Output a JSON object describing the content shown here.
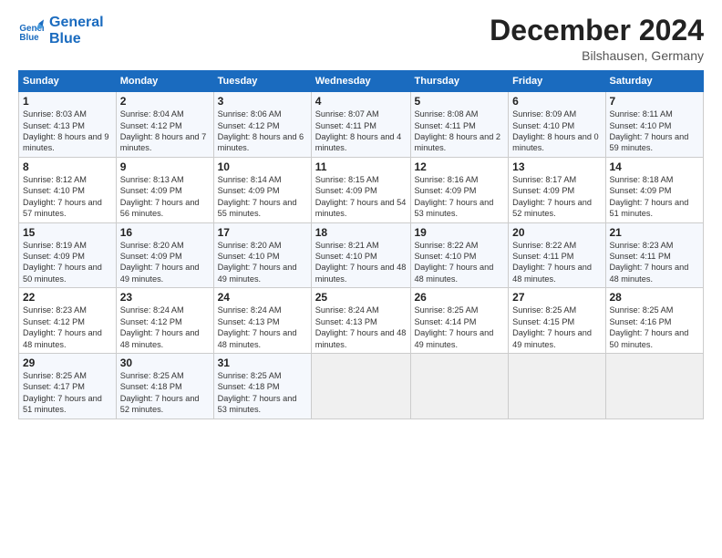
{
  "logo": {
    "line1": "General",
    "line2": "Blue"
  },
  "header": {
    "month": "December 2024",
    "location": "Bilshausen, Germany"
  },
  "days_of_week": [
    "Sunday",
    "Monday",
    "Tuesday",
    "Wednesday",
    "Thursday",
    "Friday",
    "Saturday"
  ],
  "weeks": [
    [
      {
        "day": "1",
        "sunrise": "8:03 AM",
        "sunset": "4:13 PM",
        "daylight": "8 hours and 9 minutes."
      },
      {
        "day": "2",
        "sunrise": "8:04 AM",
        "sunset": "4:12 PM",
        "daylight": "8 hours and 7 minutes."
      },
      {
        "day": "3",
        "sunrise": "8:06 AM",
        "sunset": "4:12 PM",
        "daylight": "8 hours and 6 minutes."
      },
      {
        "day": "4",
        "sunrise": "8:07 AM",
        "sunset": "4:11 PM",
        "daylight": "8 hours and 4 minutes."
      },
      {
        "day": "5",
        "sunrise": "8:08 AM",
        "sunset": "4:11 PM",
        "daylight": "8 hours and 2 minutes."
      },
      {
        "day": "6",
        "sunrise": "8:09 AM",
        "sunset": "4:10 PM",
        "daylight": "8 hours and 0 minutes."
      },
      {
        "day": "7",
        "sunrise": "8:11 AM",
        "sunset": "4:10 PM",
        "daylight": "7 hours and 59 minutes."
      }
    ],
    [
      {
        "day": "8",
        "sunrise": "8:12 AM",
        "sunset": "4:10 PM",
        "daylight": "7 hours and 57 minutes."
      },
      {
        "day": "9",
        "sunrise": "8:13 AM",
        "sunset": "4:09 PM",
        "daylight": "7 hours and 56 minutes."
      },
      {
        "day": "10",
        "sunrise": "8:14 AM",
        "sunset": "4:09 PM",
        "daylight": "7 hours and 55 minutes."
      },
      {
        "day": "11",
        "sunrise": "8:15 AM",
        "sunset": "4:09 PM",
        "daylight": "7 hours and 54 minutes."
      },
      {
        "day": "12",
        "sunrise": "8:16 AM",
        "sunset": "4:09 PM",
        "daylight": "7 hours and 53 minutes."
      },
      {
        "day": "13",
        "sunrise": "8:17 AM",
        "sunset": "4:09 PM",
        "daylight": "7 hours and 52 minutes."
      },
      {
        "day": "14",
        "sunrise": "8:18 AM",
        "sunset": "4:09 PM",
        "daylight": "7 hours and 51 minutes."
      }
    ],
    [
      {
        "day": "15",
        "sunrise": "8:19 AM",
        "sunset": "4:09 PM",
        "daylight": "7 hours and 50 minutes."
      },
      {
        "day": "16",
        "sunrise": "8:20 AM",
        "sunset": "4:09 PM",
        "daylight": "7 hours and 49 minutes."
      },
      {
        "day": "17",
        "sunrise": "8:20 AM",
        "sunset": "4:10 PM",
        "daylight": "7 hours and 49 minutes."
      },
      {
        "day": "18",
        "sunrise": "8:21 AM",
        "sunset": "4:10 PM",
        "daylight": "7 hours and 48 minutes."
      },
      {
        "day": "19",
        "sunrise": "8:22 AM",
        "sunset": "4:10 PM",
        "daylight": "7 hours and 48 minutes."
      },
      {
        "day": "20",
        "sunrise": "8:22 AM",
        "sunset": "4:11 PM",
        "daylight": "7 hours and 48 minutes."
      },
      {
        "day": "21",
        "sunrise": "8:23 AM",
        "sunset": "4:11 PM",
        "daylight": "7 hours and 48 minutes."
      }
    ],
    [
      {
        "day": "22",
        "sunrise": "8:23 AM",
        "sunset": "4:12 PM",
        "daylight": "7 hours and 48 minutes."
      },
      {
        "day": "23",
        "sunrise": "8:24 AM",
        "sunset": "4:12 PM",
        "daylight": "7 hours and 48 minutes."
      },
      {
        "day": "24",
        "sunrise": "8:24 AM",
        "sunset": "4:13 PM",
        "daylight": "7 hours and 48 minutes."
      },
      {
        "day": "25",
        "sunrise": "8:24 AM",
        "sunset": "4:13 PM",
        "daylight": "7 hours and 48 minutes."
      },
      {
        "day": "26",
        "sunrise": "8:25 AM",
        "sunset": "4:14 PM",
        "daylight": "7 hours and 49 minutes."
      },
      {
        "day": "27",
        "sunrise": "8:25 AM",
        "sunset": "4:15 PM",
        "daylight": "7 hours and 49 minutes."
      },
      {
        "day": "28",
        "sunrise": "8:25 AM",
        "sunset": "4:16 PM",
        "daylight": "7 hours and 50 minutes."
      }
    ],
    [
      {
        "day": "29",
        "sunrise": "8:25 AM",
        "sunset": "4:17 PM",
        "daylight": "7 hours and 51 minutes."
      },
      {
        "day": "30",
        "sunrise": "8:25 AM",
        "sunset": "4:18 PM",
        "daylight": "7 hours and 52 minutes."
      },
      {
        "day": "31",
        "sunrise": "8:25 AM",
        "sunset": "4:18 PM",
        "daylight": "7 hours and 53 minutes."
      },
      null,
      null,
      null,
      null
    ]
  ],
  "labels": {
    "sunrise": "Sunrise:",
    "sunset": "Sunset:",
    "daylight": "Daylight:"
  }
}
